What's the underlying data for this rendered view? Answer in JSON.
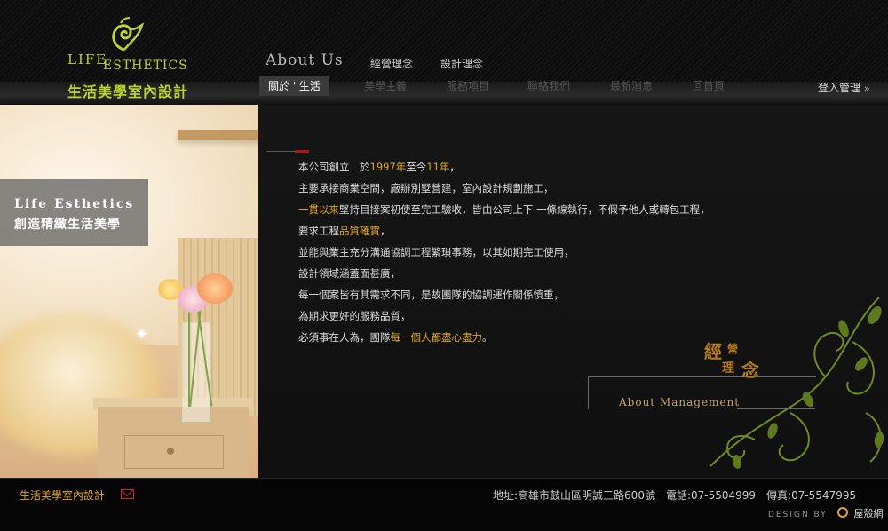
{
  "logo": {
    "line1": "LIFE",
    "line2": "ESTHETICS",
    "chinese": "生活美學室內設計"
  },
  "section": {
    "title": "About Us",
    "subnav": [
      "經營理念",
      "設計理念"
    ]
  },
  "nav": {
    "items": [
      {
        "label": "關於 ' 生活",
        "active": true
      },
      {
        "label": "美學主義",
        "active": false
      },
      {
        "label": "服務項目",
        "active": false
      },
      {
        "label": "聯絡我們",
        "active": false
      },
      {
        "label": "最新消息",
        "active": false
      },
      {
        "label": "回首頁",
        "active": false
      }
    ],
    "login": "登入管理",
    "login_icon": "double-chevron-right"
  },
  "hero": {
    "tagline_en": "Life Esthetics",
    "tagline_cn": "創造精緻生活美學"
  },
  "content": {
    "paragraphs": [
      {
        "segments": [
          {
            "t": "本公司創立　於"
          },
          {
            "t": "1997年",
            "hl": true
          },
          {
            "t": "至今"
          },
          {
            "t": "11年",
            "hl": true
          },
          {
            "t": "，"
          }
        ]
      },
      {
        "segments": [
          {
            "t": "主要承接商業空間，廠辦別墅營建，室內設計規劃施工，"
          }
        ]
      },
      {
        "segments": [
          {
            "t": "一貫以來",
            "hl": true
          },
          {
            "t": "堅持目接案初使至完工驗收，皆由公司上下 一條線執行，不假予他人或轉包工程，"
          }
        ]
      },
      {
        "segments": [
          {
            "t": "要求工程"
          },
          {
            "t": "品質確實",
            "hl": true
          },
          {
            "t": "，"
          }
        ]
      },
      {
        "segments": [
          {
            "t": "並能與業主充分溝通協調工程繁瑣事務，以其如期完工使用，"
          }
        ]
      },
      {
        "segments": [
          {
            "t": "設計領域涵蓋面甚廣，"
          }
        ]
      },
      {
        "segments": [
          {
            "t": "每一個案皆有其需求不同，是故團隊的協調運作關係慎重，"
          }
        ]
      },
      {
        "segments": [
          {
            "t": "為期求更好的服務品質，"
          }
        ]
      },
      {
        "segments": [
          {
            "t": "必須事在人為，團隊"
          },
          {
            "t": "每一個人都盡心盡力",
            "hl": true
          },
          {
            "t": "。"
          }
        ]
      }
    ]
  },
  "management": {
    "char1": "經",
    "char2": "營",
    "char3": "理",
    "char4": "念",
    "english": "About Management"
  },
  "footer": {
    "company": "生活美學室內設計",
    "address": "地址:高雄市鼓山區明誠三路600號　電話:07-5504999　傳真:07-5547995",
    "design_by": "DESIGN BY",
    "designer": "屋殼網"
  },
  "colors": {
    "accent_green": "#b9d52f",
    "highlight_gold": "#e0a628",
    "management_bronze": "#b27a1e",
    "accent_red": "#a31c1c"
  }
}
